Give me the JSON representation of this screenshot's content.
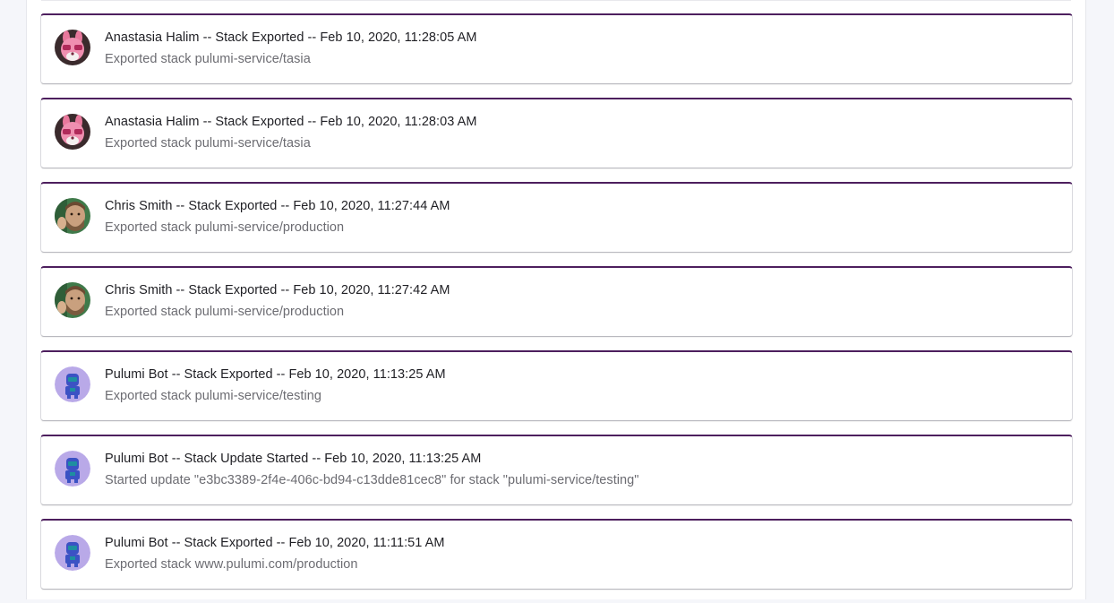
{
  "events": [
    {
      "avatar": "avatar-pink-bunny-icon",
      "title": "Anastasia Halim -- Stack Exported -- Feb 10, 2020, 11:28:05 AM",
      "description": "Exported stack pulumi-service/tasia"
    },
    {
      "avatar": "avatar-pink-bunny-icon",
      "title": "Anastasia Halim -- Stack Exported -- Feb 10, 2020, 11:28:03 AM",
      "description": "Exported stack pulumi-service/tasia"
    },
    {
      "avatar": "avatar-person-photo-icon",
      "title": "Chris Smith -- Stack Exported -- Feb 10, 2020, 11:27:44 AM",
      "description": "Exported stack pulumi-service/production"
    },
    {
      "avatar": "avatar-person-photo-icon",
      "title": "Chris Smith -- Stack Exported -- Feb 10, 2020, 11:27:42 AM",
      "description": "Exported stack pulumi-service/production"
    },
    {
      "avatar": "avatar-robot-icon",
      "title": "Pulumi Bot -- Stack Exported -- Feb 10, 2020, 11:13:25 AM",
      "description": "Exported stack pulumi-service/testing"
    },
    {
      "avatar": "avatar-robot-icon",
      "title": "Pulumi Bot -- Stack Update Started -- Feb 10, 2020, 11:13:25 AM",
      "description": "Started update \"e3bc3389-2f4e-406c-bd94-c13dde81cec8\" for stack \"pulumi-service/testing\""
    },
    {
      "avatar": "avatar-robot-icon",
      "title": "Pulumi Bot -- Stack Exported -- Feb 10, 2020, 11:11:51 AM",
      "description": "Exported stack www.pulumi.com/production"
    }
  ],
  "colors": {
    "card_accent": "#4d1f5e",
    "page_background": "#f5f6fa",
    "title_text": "#1f1f24",
    "description_text": "#6c6c72"
  }
}
